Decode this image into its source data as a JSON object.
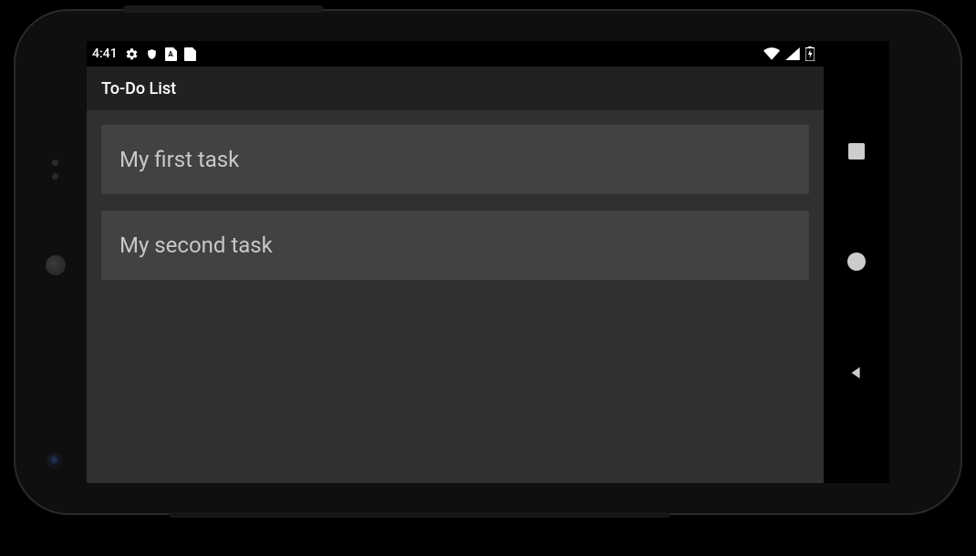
{
  "status": {
    "clock": "4:41",
    "icons": {
      "settings": "gear-icon",
      "shield": "shield-icon",
      "card_a_letter": "A",
      "sd": "sd-card-icon",
      "wifi": "wifi-icon",
      "cell": "cell-signal-icon",
      "battery": "battery-charging-icon"
    }
  },
  "action_bar": {
    "title": "To-Do List"
  },
  "tasks": [
    {
      "label": "My first task"
    },
    {
      "label": "My second task"
    }
  ],
  "nav": {
    "recent": "recent-apps-button",
    "home": "home-button",
    "back": "back-button"
  }
}
